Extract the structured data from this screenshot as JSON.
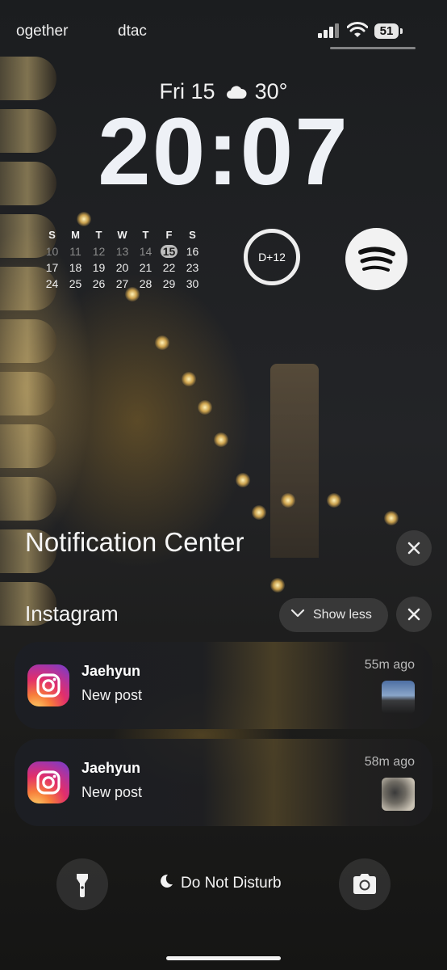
{
  "status_bar": {
    "carrier_left": "ogether",
    "carrier_right": "dtac",
    "battery": "51"
  },
  "lock_screen": {
    "date": "Fri 15",
    "weather_temp": "30°",
    "time": "20:07"
  },
  "calendar": {
    "headers": [
      "S",
      "M",
      "T",
      "W",
      "T",
      "F",
      "S"
    ],
    "weeks": [
      [
        "10",
        "11",
        "12",
        "13",
        "14",
        "15",
        "16"
      ],
      [
        "17",
        "18",
        "19",
        "20",
        "21",
        "22",
        "23"
      ],
      [
        "24",
        "25",
        "26",
        "27",
        "28",
        "29",
        "30"
      ]
    ],
    "today": "15"
  },
  "widgets": {
    "countdown_label": "D+12",
    "music_app_icon": "spotify-icon"
  },
  "notification_center": {
    "title": "Notification Center",
    "group": {
      "app_name": "Instagram",
      "show_less_label": "Show less",
      "notifications": [
        {
          "sender": "Jaehyun",
          "message": "New post",
          "time": "55m ago"
        },
        {
          "sender": "Jaehyun",
          "message": "New post",
          "time": "58m ago"
        }
      ]
    }
  },
  "bottom_bar": {
    "focus_label": "Do Not Disturb",
    "left_icon": "flashlight-icon",
    "right_icon": "camera-icon"
  }
}
